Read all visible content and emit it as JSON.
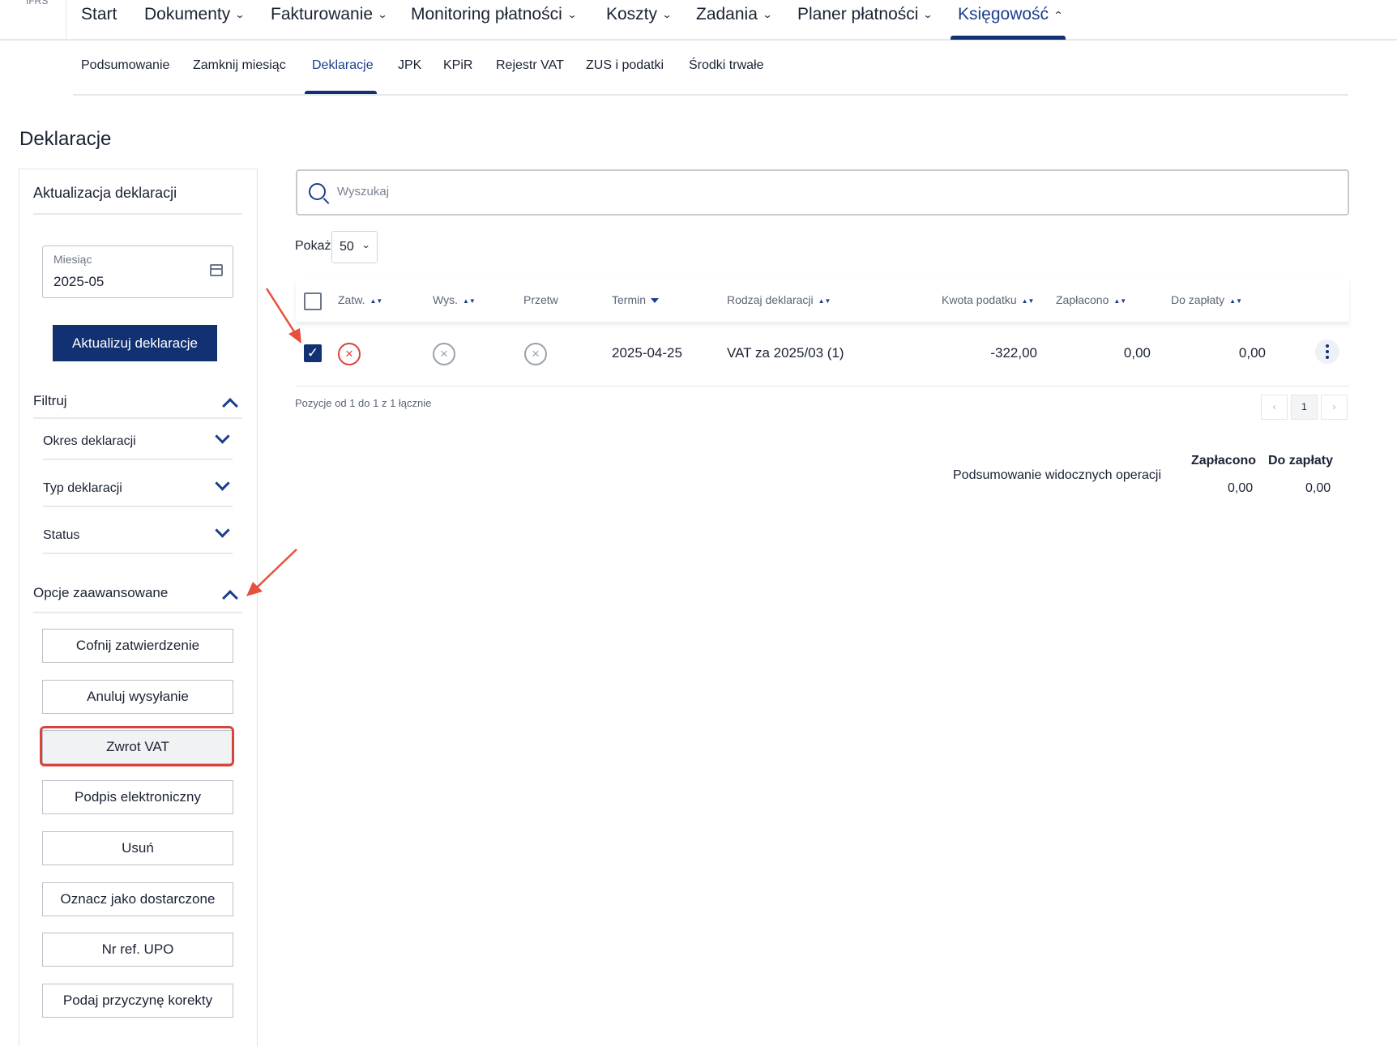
{
  "brand": "IFRS",
  "nav": {
    "items": [
      {
        "label": "Start",
        "has_dropdown": false
      },
      {
        "label": "Dokumenty",
        "has_dropdown": true
      },
      {
        "label": "Fakturowanie",
        "has_dropdown": true
      },
      {
        "label": "Monitoring płatności",
        "has_dropdown": true
      },
      {
        "label": "Koszty",
        "has_dropdown": true
      },
      {
        "label": "Zadania",
        "has_dropdown": true
      },
      {
        "label": "Planer płatności",
        "has_dropdown": true
      },
      {
        "label": "Księgowość",
        "has_dropdown": true,
        "active": true
      }
    ]
  },
  "subnav": {
    "items": [
      {
        "label": "Podsumowanie"
      },
      {
        "label": "Zamknij miesiąc"
      },
      {
        "label": "Deklaracje",
        "active": true
      },
      {
        "label": "JPK"
      },
      {
        "label": "KPiR"
      },
      {
        "label": "Rejestr VAT"
      },
      {
        "label": "ZUS i podatki"
      },
      {
        "label": "Środki trwałe"
      }
    ]
  },
  "page_title": "Deklaracje",
  "left_panel": {
    "title": "Aktualizacja deklaracji",
    "month": {
      "label": "Miesiąc",
      "value": "2025-05"
    },
    "update_button": "Aktualizuj deklaracje",
    "filter_title": "Filtruj",
    "filters": [
      {
        "label": "Okres deklaracji"
      },
      {
        "label": "Typ deklaracji"
      },
      {
        "label": "Status"
      }
    ],
    "advanced_title": "Opcje zaawansowane",
    "options": [
      {
        "label": "Cofnij zatwierdzenie"
      },
      {
        "label": "Anuluj wysyłanie"
      },
      {
        "label": "Zwrot VAT",
        "highlighted": true
      },
      {
        "label": "Podpis elektroniczny"
      },
      {
        "label": "Usuń"
      },
      {
        "label": "Oznacz jako dostarczone"
      },
      {
        "label": "Nr ref. UPO"
      },
      {
        "label": "Podaj przyczynę korekty"
      }
    ]
  },
  "search": {
    "placeholder": "Wyszukaj"
  },
  "show": {
    "label": "Pokaż",
    "value": "50"
  },
  "table": {
    "columns": [
      "Zatw.",
      "Wys.",
      "Przetw",
      "Termin",
      "Rodzaj deklaracji",
      "Kwota podatku",
      "Zapłacono",
      "Do zapłaty"
    ],
    "rows": [
      {
        "checked": true,
        "approved_status": "rejected",
        "sent_status": "none",
        "processed_status": "none",
        "due_date": "2025-04-25",
        "declaration_type": "VAT za 2025/03 (1)",
        "tax_amount": "-322,00",
        "paid": "0,00",
        "to_pay": "0,00"
      }
    ],
    "positions_text": "Pozycje od 1 do 1 z 1 łącznie",
    "pagination": {
      "prev": "‹",
      "current": "1",
      "next": "›"
    }
  },
  "summary": {
    "label": "Podsumowanie widocznych operacji",
    "paid_header": "Zapłacono",
    "to_pay_header": "Do zapłaty",
    "paid_value": "0,00",
    "to_pay_value": "0,00"
  },
  "colors": {
    "primary": "#123173",
    "accent_text": "#1d3e8c",
    "annotation_red": "#d7443b"
  }
}
